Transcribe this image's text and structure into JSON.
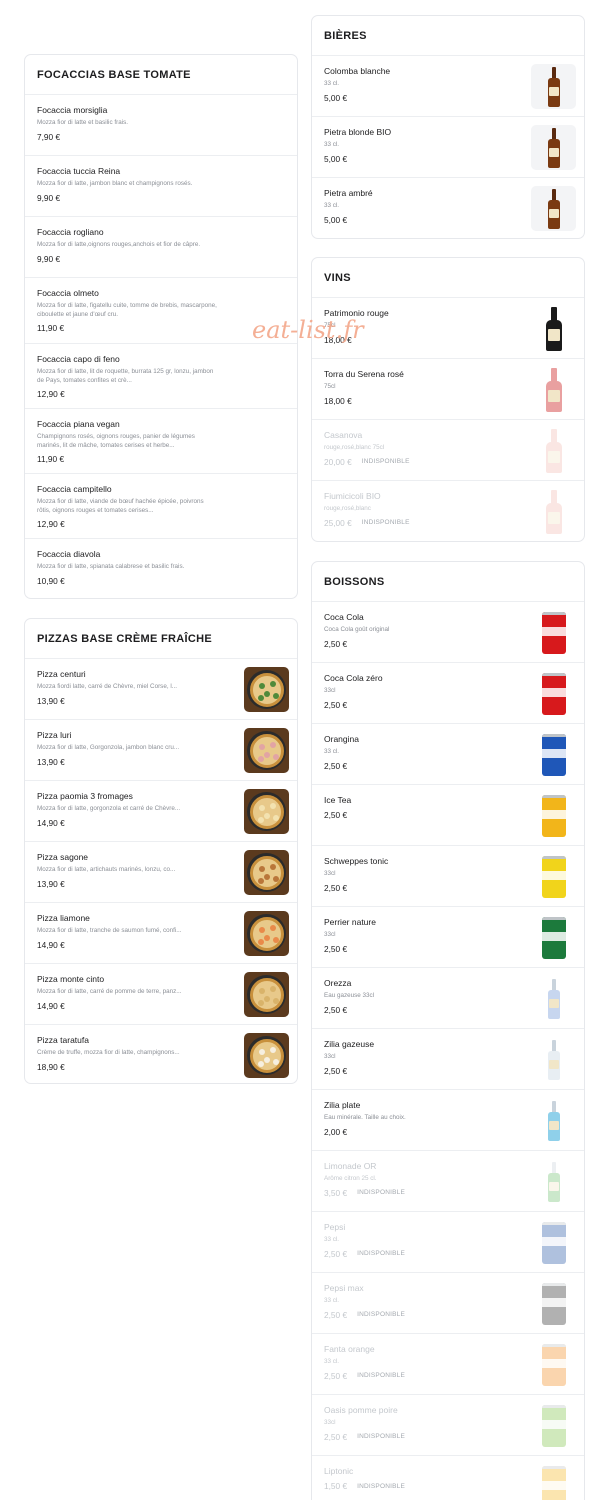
{
  "watermark": "eat-list.fr",
  "focaccias": {
    "title": "FOCACCIAS BASE TOMATE",
    "items": [
      {
        "name": "Focaccia morsiglia",
        "desc": "Mozza fior di latte et basilic frais.",
        "price": "7,90 €"
      },
      {
        "name": "Focaccia tuccia Reina",
        "desc": "Mozza fior di latte, jambon blanc et champignons rosés.",
        "price": "9,90 €"
      },
      {
        "name": "Focaccia rogliano",
        "desc": "Mozza fior di latte,oignons rouges,anchois et fior de câpre.",
        "price": "9,90 €"
      },
      {
        "name": "Focaccia olmeto",
        "desc": "Mozza fior di latte, figatellu cuite, tomme de brebis, mascarpone, ciboulette et jaune d'œuf cru.",
        "price": "11,90 €"
      },
      {
        "name": "Focaccia capo di feno",
        "desc": "Mozza fior di latte, lit de roquette, burrata 125 gr, lonzu, jambon de Pays, tomates confites et crè...",
        "price": "12,90 €"
      },
      {
        "name": "Focaccia piana vegan",
        "desc": "Champignons rosés, oignons rouges, panier de légumes marinés, lit de mâche, tomates cerises et herbe...",
        "price": "11,90 €"
      },
      {
        "name": "Focaccia campitello",
        "desc": "Mozza fior di latte, viande de bœuf hachée épicée, poivrons rôtis, oignons rouges et tomates cerises...",
        "price": "12,90 €"
      },
      {
        "name": "Focaccia diavola",
        "desc": "Mozza fior di latte, spianata calabrese et basilic frais.",
        "price": "10,90 €"
      }
    ]
  },
  "pizzas": {
    "title": "PIZZAS BASE CRÈME FRAÎCHE",
    "items": [
      {
        "name": "Pizza centuri",
        "desc": "Mozza fiordi latte, carré de Chèvre, miel Corse, l...",
        "price": "13,90 €",
        "topping": "#4f8a3a"
      },
      {
        "name": "Pizza luri",
        "desc": "Mozza fior di latte, Gorgonzola, jambon blanc cru...",
        "price": "13,90 €",
        "topping": "#e2a4a4"
      },
      {
        "name": "Pizza paomia 3 fromages",
        "desc": "Mozza fior di latte, gorgonzola et carré de Chèvre...",
        "price": "14,90 €",
        "topping": "#f3e2b0"
      },
      {
        "name": "Pizza sagone",
        "desc": "Mozza fior di latte, artichauts marinés, lonzu, co...",
        "price": "13,90 €",
        "topping": "#b9763a"
      },
      {
        "name": "Pizza liamone",
        "desc": "Mozza fior di latte, tranche de saumon fumé, confi...",
        "price": "14,90 €",
        "topping": "#e98a4a"
      },
      {
        "name": "Pizza monte cinto",
        "desc": "Mozza fior di latte, carré de pomme de terre, panz...",
        "price": "14,90 €",
        "topping": "#d9b36a"
      },
      {
        "name": "Pizza taratufa",
        "desc": "Crème de truffe, mozza fior di latte, champignons...",
        "price": "18,90 €",
        "topping": "#f6efe0"
      }
    ]
  },
  "bieres": {
    "title": "BIÈRES",
    "items": [
      {
        "name": "Colomba blanche",
        "desc": "33 cl.",
        "price": "5,00 €"
      },
      {
        "name": "Pietra blonde BIO",
        "desc": "33 cl.",
        "price": "5,00 €"
      },
      {
        "name": "Pietra ambré",
        "desc": "33 cl.",
        "price": "5,00 €"
      }
    ]
  },
  "vins": {
    "title": "VINS",
    "items": [
      {
        "name": "Patrimonio rouge",
        "desc": "75cl",
        "price": "18,00 €",
        "available": true,
        "color": "#1a1a1a"
      },
      {
        "name": "Torra du Serena rosé",
        "desc": "75cl",
        "price": "18,00 €",
        "available": true,
        "color": "#e9a0a0"
      },
      {
        "name": "Casanova",
        "desc": "rouge,rosé,blanc 75cl",
        "price": "20,00 €",
        "available": false,
        "badge": "INDISPONIBLE",
        "color": "#f2b9b0"
      },
      {
        "name": "Fiumicicoli BIO",
        "desc": "rouge,rosé,blanc",
        "price": "25,00 €",
        "available": false,
        "badge": "INDISPONIBLE",
        "color": "#f2b9b0"
      }
    ]
  },
  "boissons": {
    "title": "BOISSONS",
    "items": [
      {
        "name": "Coca Cola",
        "desc": "Coca Cola goût original",
        "price": "2,50 €",
        "available": true,
        "color": "#d7191c"
      },
      {
        "name": "Coca Cola zéro",
        "desc": "33cl",
        "price": "2,50 €",
        "available": true,
        "color": "#d7191c"
      },
      {
        "name": "Orangina",
        "desc": "33 cl.",
        "price": "2,50 €",
        "available": true,
        "color": "#1f57b8"
      },
      {
        "name": "Ice Tea",
        "desc": "",
        "price": "2,50 €",
        "available": true,
        "color": "#f2b51a"
      },
      {
        "name": "Schweppes tonic",
        "desc": "33cl",
        "price": "2,50 €",
        "available": true,
        "color": "#f1d41b"
      },
      {
        "name": "Perrier nature",
        "desc": "33cl",
        "price": "2,50 €",
        "available": true,
        "color": "#1c7a3c"
      },
      {
        "name": "Orezza",
        "desc": "Eau gazeuse 33cl",
        "price": "2,50 €",
        "available": true,
        "color": "#c7d6ef",
        "kind": "bottle"
      },
      {
        "name": "Zilia gazeuse",
        "desc": "33cl",
        "price": "2,50 €",
        "available": true,
        "color": "#e8eef3",
        "kind": "bottle"
      },
      {
        "name": "Zilia plate",
        "desc": "Eau minérale. Taille au choix.",
        "price": "2,00 €",
        "available": true,
        "color": "#8fd0ea",
        "kind": "bottle"
      },
      {
        "name": "Limonade OR",
        "desc": "Arôme citron 25 cl.",
        "price": "3,50 €",
        "available": false,
        "badge": "INDISPONIBLE",
        "color": "#6cbf6c",
        "kind": "bottle"
      },
      {
        "name": "Pepsi",
        "desc": "33 cl.",
        "price": "2,50 €",
        "available": false,
        "badge": "INDISPONIBLE",
        "color": "#1d4fa3"
      },
      {
        "name": "Pepsi max",
        "desc": "33 cl.",
        "price": "2,50 €",
        "available": false,
        "badge": "INDISPONIBLE",
        "color": "#222222"
      },
      {
        "name": "Fanta orange",
        "desc": "33 cl.",
        "price": "2,50 €",
        "available": false,
        "badge": "INDISPONIBLE",
        "color": "#f28a1a"
      },
      {
        "name": "Oasis pomme poire",
        "desc": "33cl",
        "price": "2,50 €",
        "available": false,
        "badge": "INDISPONIBLE",
        "color": "#7ac143"
      },
      {
        "name": "Liptonic",
        "desc": "",
        "price": "1,50 €",
        "available": false,
        "badge": "INDISPONIBLE",
        "color": "#f2b51a"
      }
    ]
  }
}
